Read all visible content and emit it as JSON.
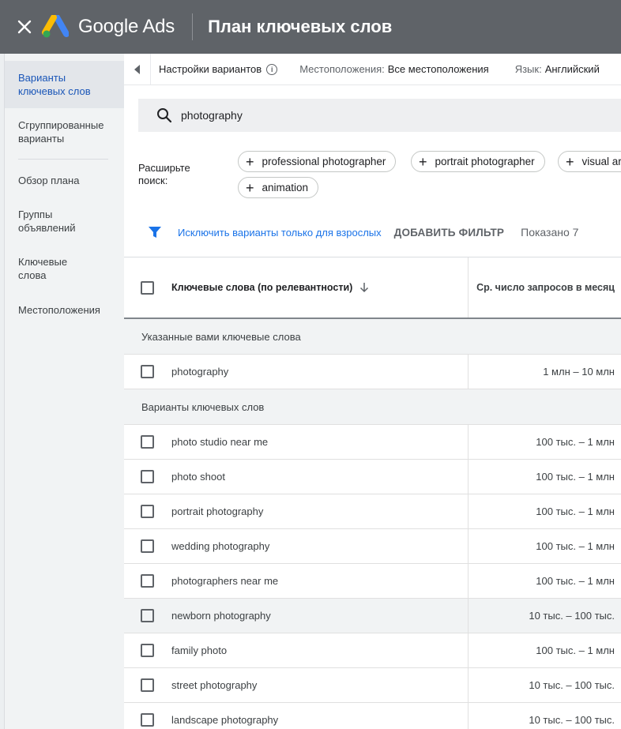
{
  "header": {
    "close_label": "×",
    "logo_text": "Google Ads",
    "title": "План ключевых слов"
  },
  "sidebar": {
    "items": [
      {
        "label_line1": "Варианты",
        "label_line2": "ключевых слов",
        "active": true
      },
      {
        "label_line1": "Сгруппированные",
        "label_line2": "варианты",
        "active": false
      },
      {
        "label_line1": "Обзор плана",
        "label_line2": "",
        "active": false
      },
      {
        "label_line1": "Группы",
        "label_line2": "объявлений",
        "active": false
      },
      {
        "label_line1": "Ключевые",
        "label_line2": "слова",
        "active": false
      },
      {
        "label_line1": "Местоположения",
        "label_line2": "",
        "active": false
      }
    ]
  },
  "settings_bar": {
    "settings_label": "Настройки вариантов",
    "info_glyph": "i",
    "locations_label": "Местоположения:",
    "locations_value": "Все местоположения",
    "language_label": "Язык:",
    "language_value": "Английский"
  },
  "search": {
    "value": "photography",
    "expand_label_line1": "Расширьте",
    "expand_label_line2": "поиск:",
    "chips": [
      {
        "label": "professional photographer"
      },
      {
        "label": "portrait photographer"
      },
      {
        "label": "visual arts"
      },
      {
        "label": "animation"
      }
    ]
  },
  "filter_bar": {
    "exclude_adult_label": "Исключить варианты только для взрослых",
    "add_filter_label": "ДОБАВИТЬ ФИЛЬТР",
    "shown_label": "Показано 7"
  },
  "table": {
    "col_keyword_header": "Ключевые слова (по релевантности)",
    "col_volume_header": "Ср. число запросов в месяц",
    "provided_group_label": "Указанные вами ключевые слова",
    "provided": [
      {
        "keyword": "photography",
        "volume": "1 млн – 10 млн"
      }
    ],
    "ideas_group_label": "Варианты ключевых слов",
    "ideas": [
      {
        "keyword": "photo studio near me",
        "volume": "100 тыс. – 1 млн"
      },
      {
        "keyword": "photo shoot",
        "volume": "100 тыс. – 1 млн"
      },
      {
        "keyword": "portrait photography",
        "volume": "100 тыс. – 1 млн"
      },
      {
        "keyword": "wedding photography",
        "volume": "100 тыс. – 1 млн"
      },
      {
        "keyword": "photographers near me",
        "volume": "100 тыс. – 1 млн"
      },
      {
        "keyword": "newborn photography",
        "volume": "10 тыс. – 100 тыс."
      },
      {
        "keyword": "family photo",
        "volume": "100 тыс. – 1 млн"
      },
      {
        "keyword": "street photography",
        "volume": "10 тыс. – 100 тыс."
      },
      {
        "keyword": "landscape photography",
        "volume": "10 тыс. – 100 тыс."
      }
    ]
  },
  "colors": {
    "topbar": "#5f6368",
    "accent_blue": "#1a73e8",
    "sidebar_bg": "#f1f3f4"
  }
}
